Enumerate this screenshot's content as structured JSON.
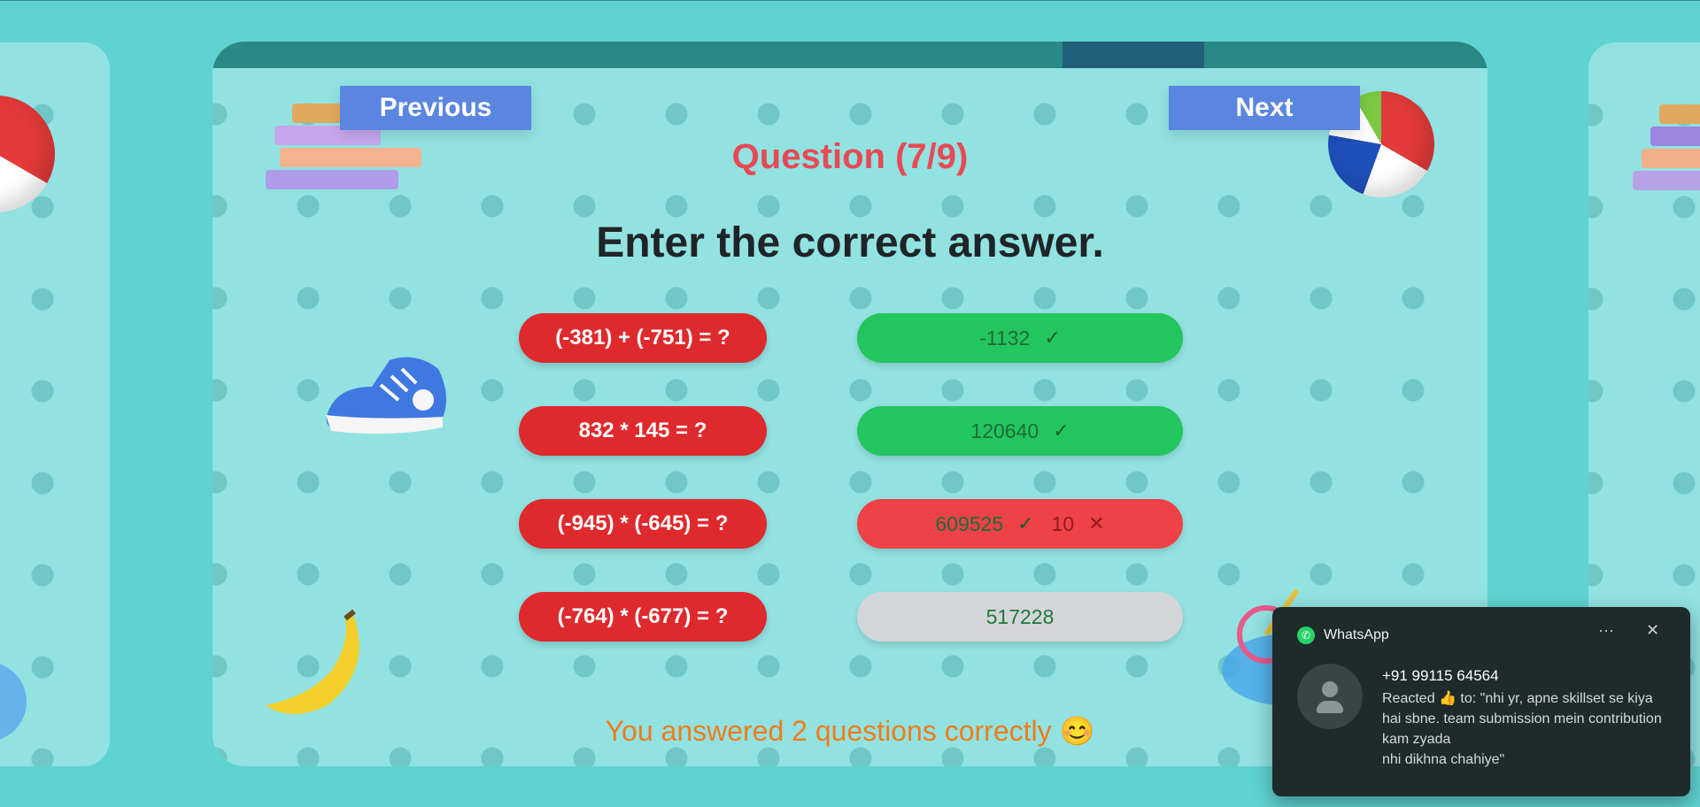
{
  "navigation": {
    "previous_label": "Previous",
    "next_label": "Next"
  },
  "question": {
    "title": "Question (7/9)",
    "progress_current": 7,
    "progress_total": 9,
    "instruction": "Enter the correct answer."
  },
  "rows": [
    {
      "question": "(-381) + (-751) = ?",
      "answer": "-1132",
      "status": "correct"
    },
    {
      "question": "832 * 145 = ?",
      "answer": "120640",
      "status": "correct"
    },
    {
      "question": "(-945) * (-645) = ?",
      "answer": "609525",
      "wrong_answer": "10",
      "status": "wrong"
    },
    {
      "question": "(-764) * (-677) = ?",
      "answer": "517228",
      "status": "unanswered"
    }
  ],
  "result": {
    "text": "You answered 2 questions correctly 😊"
  },
  "toast": {
    "app_name": "WhatsApp",
    "sender": "+91 99115 64564",
    "message": "Reacted 👍 to: \"nhi yr, apne skillset se kiya hai sbne. team submission mein contribution kam zyada\nnhi dikhna chahiye\"",
    "more_icon": "···",
    "close_icon": "✕"
  },
  "colors": {
    "background": "#5fd3d1",
    "card": "#92e2e1",
    "question_pill": "#de2a2d",
    "correct": "#23c55e",
    "wrong": "#ee4246",
    "neutral": "#d4d5d9",
    "nav_button": "#5b86e0",
    "title": "#e64a55",
    "result": "#f07c1c"
  },
  "icons": [
    "check-icon",
    "cross-icon",
    "whatsapp-icon",
    "more-icon",
    "close-icon",
    "avatar-icon"
  ]
}
